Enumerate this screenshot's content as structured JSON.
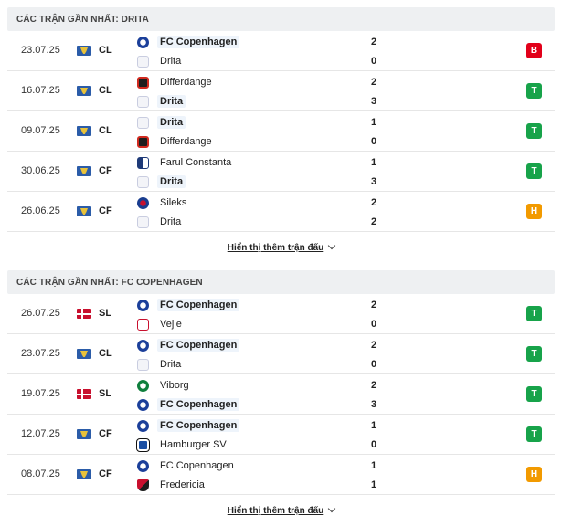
{
  "sections": [
    {
      "header": "CÁC TRẬN GẦN NHẤT: DRITA",
      "more_label": "Hiển thị thêm trận đấu",
      "matches": [
        {
          "date": "23.07.25",
          "flag": "cup",
          "comp": "CL",
          "home": "FC Copenhagen",
          "home_logo": "fck",
          "home_win": true,
          "away": "Drita",
          "away_logo": "drita",
          "away_win": false,
          "home_score": "2",
          "away_score": "0",
          "result": "B"
        },
        {
          "date": "16.07.25",
          "flag": "cup",
          "comp": "CL",
          "home": "Differdange",
          "home_logo": "diff",
          "home_win": false,
          "away": "Drita",
          "away_logo": "drita",
          "away_win": true,
          "home_score": "2",
          "away_score": "3",
          "result": "T"
        },
        {
          "date": "09.07.25",
          "flag": "cup",
          "comp": "CL",
          "home": "Drita",
          "home_logo": "drita",
          "home_win": true,
          "away": "Differdange",
          "away_logo": "diff",
          "away_win": false,
          "home_score": "1",
          "away_score": "0",
          "result": "T"
        },
        {
          "date": "30.06.25",
          "flag": "cup",
          "comp": "CF",
          "home": "Farul Constanta",
          "home_logo": "farul",
          "home_win": false,
          "away": "Drita",
          "away_logo": "drita",
          "away_win": true,
          "home_score": "1",
          "away_score": "3",
          "result": "T"
        },
        {
          "date": "26.06.25",
          "flag": "cup",
          "comp": "CF",
          "home": "Sileks",
          "home_logo": "sileks",
          "home_win": false,
          "away": "Drita",
          "away_logo": "drita",
          "away_win": false,
          "home_score": "2",
          "away_score": "2",
          "result": "H"
        }
      ]
    },
    {
      "header": "CÁC TRẬN GẦN NHẤT: FC COPENHAGEN",
      "more_label": "Hiển thị thêm trận đấu",
      "matches": [
        {
          "date": "26.07.25",
          "flag": "dk",
          "comp": "SL",
          "home": "FC Copenhagen",
          "home_logo": "fck",
          "home_win": true,
          "away": "Vejle",
          "away_logo": "vejle",
          "away_win": false,
          "home_score": "2",
          "away_score": "0",
          "result": "T"
        },
        {
          "date": "23.07.25",
          "flag": "cup",
          "comp": "CL",
          "home": "FC Copenhagen",
          "home_logo": "fck",
          "home_win": true,
          "away": "Drita",
          "away_logo": "drita",
          "away_win": false,
          "home_score": "2",
          "away_score": "0",
          "result": "T"
        },
        {
          "date": "19.07.25",
          "flag": "dk",
          "comp": "SL",
          "home": "Viborg",
          "home_logo": "viborg",
          "home_win": false,
          "away": "FC Copenhagen",
          "away_logo": "fck",
          "away_win": true,
          "home_score": "2",
          "away_score": "3",
          "result": "T"
        },
        {
          "date": "12.07.25",
          "flag": "cup",
          "comp": "CF",
          "home": "FC Copenhagen",
          "home_logo": "fck",
          "home_win": true,
          "away": "Hamburger SV",
          "away_logo": "hsv",
          "away_win": false,
          "home_score": "1",
          "away_score": "0",
          "result": "T"
        },
        {
          "date": "08.07.25",
          "flag": "cup",
          "comp": "CF",
          "home": "FC Copenhagen",
          "home_logo": "fck",
          "home_win": false,
          "away": "Fredericia",
          "away_logo": "fred",
          "away_win": false,
          "home_score": "1",
          "away_score": "1",
          "result": "H"
        }
      ]
    }
  ],
  "colors": {
    "loss": "#e2001a",
    "win": "#17a34a",
    "draw": "#f29a00",
    "header_bg": "#eef0f2"
  },
  "icons": {
    "cup": "competition-cup-flag",
    "dk": "denmark-flag",
    "chevron": "chevron-down-icon"
  }
}
